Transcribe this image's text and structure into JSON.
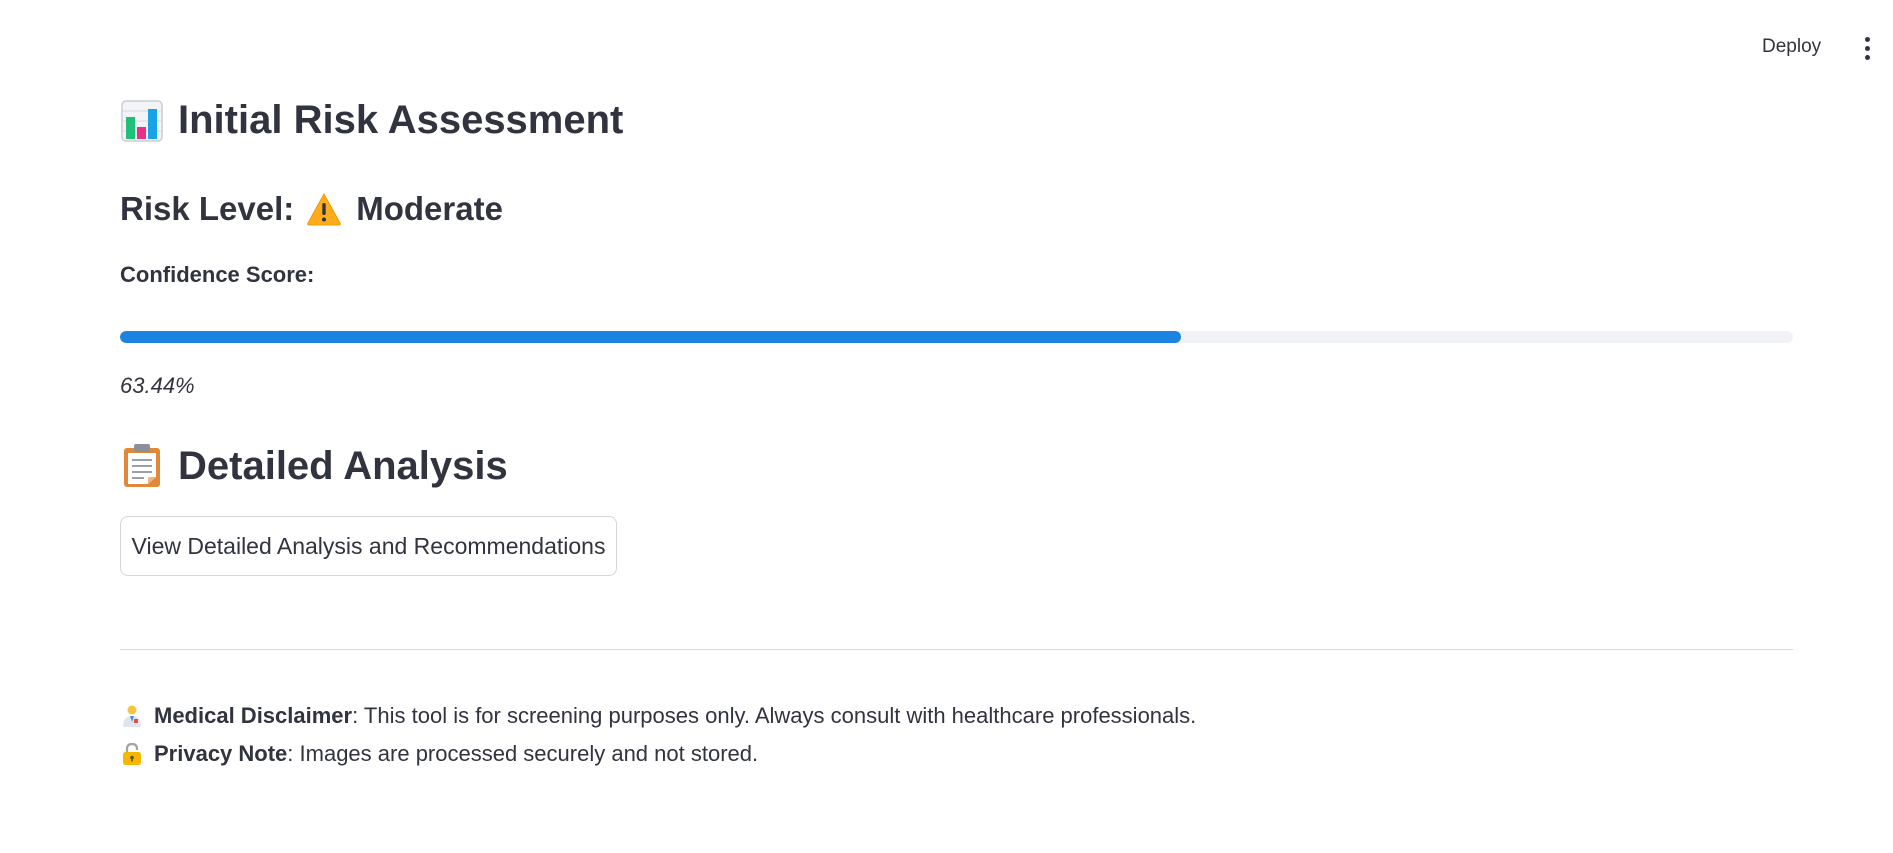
{
  "header": {
    "deploy_label": "Deploy",
    "menu_icon": "vertical-ellipsis-icon"
  },
  "assessment": {
    "title_icon": "bar-chart-icon",
    "title": "Initial Risk Assessment",
    "risk_prefix": "Risk Level:",
    "risk_icon": "warning-icon",
    "risk_value": "Moderate",
    "confidence_label": "Confidence Score:",
    "confidence_fraction": 0.6344,
    "confidence_text": "63.44%",
    "progress_color": "#1c83e1"
  },
  "analysis": {
    "title_icon": "clipboard-icon",
    "title": "Detailed Analysis",
    "button_label": "View Detailed Analysis and Recommendations"
  },
  "footer": {
    "disclaimer_icon": "health-worker-icon",
    "disclaimer_label": "Medical Disclaimer",
    "disclaimer_text": ": This tool is for screening purposes only. Always consult with healthcare professionals.",
    "privacy_icon": "lock-icon",
    "privacy_label": "Privacy Note",
    "privacy_text": ": Images are processed securely and not stored."
  }
}
